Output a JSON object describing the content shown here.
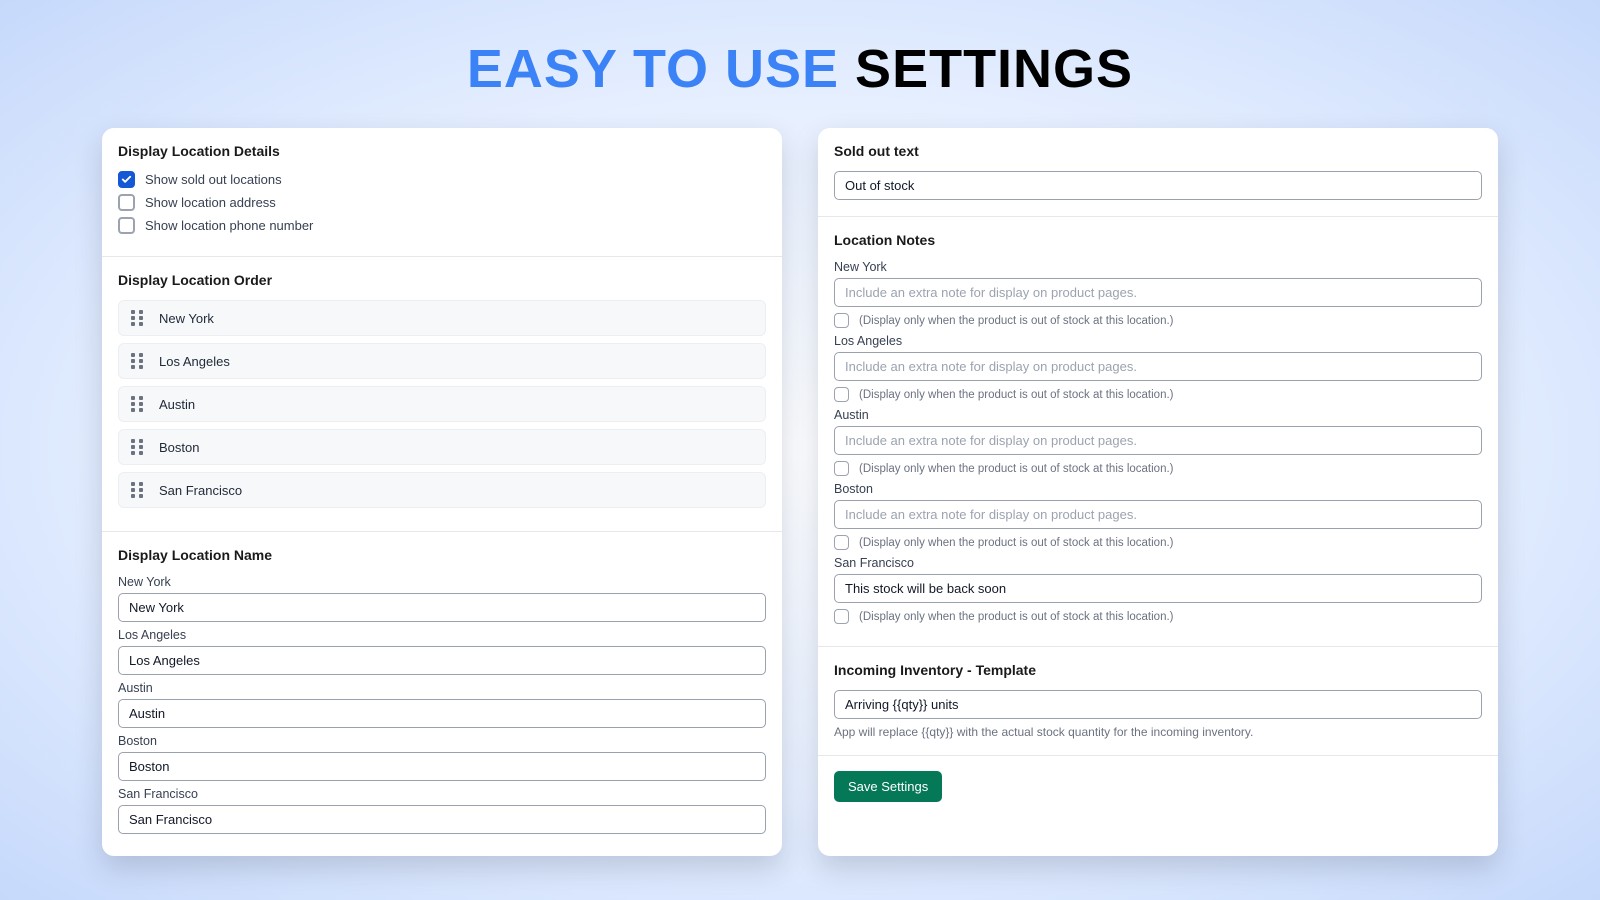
{
  "hero": {
    "part1": "EASY TO USE",
    "part2": "SETTINGS"
  },
  "left": {
    "details": {
      "title": "Display Location Details",
      "chk1": "Show sold out locations",
      "chk2": "Show location address",
      "chk3": "Show location phone number"
    },
    "order": {
      "title": "Display Location Order",
      "items": [
        "New York",
        "Los Angeles",
        "Austin",
        "Boston",
        "San Francisco"
      ]
    },
    "names": {
      "title": "Display Location Name",
      "rows": [
        {
          "label": "New York",
          "value": "New York"
        },
        {
          "label": "Los Angeles",
          "value": "Los Angeles"
        },
        {
          "label": "Austin",
          "value": "Austin"
        },
        {
          "label": "Boston",
          "value": "Boston"
        },
        {
          "label": "San Francisco",
          "value": "San Francisco"
        }
      ]
    }
  },
  "right": {
    "soldOut": {
      "title": "Sold out text",
      "value": "Out of stock"
    },
    "notes": {
      "title": "Location Notes",
      "placeholder": "Include an extra note for display on product pages.",
      "chkText": "(Display only when the product is out of stock at this location.)",
      "rows": [
        {
          "label": "New York",
          "value": ""
        },
        {
          "label": "Los Angeles",
          "value": ""
        },
        {
          "label": "Austin",
          "value": ""
        },
        {
          "label": "Boston",
          "value": ""
        },
        {
          "label": "San Francisco",
          "value": "This stock will be back soon"
        }
      ]
    },
    "incoming": {
      "title": "Incoming Inventory - Template",
      "value": "Arriving {{qty}} units",
      "help": "App will replace {{qty}} with the actual stock quantity for the incoming inventory."
    },
    "save": "Save Settings"
  }
}
